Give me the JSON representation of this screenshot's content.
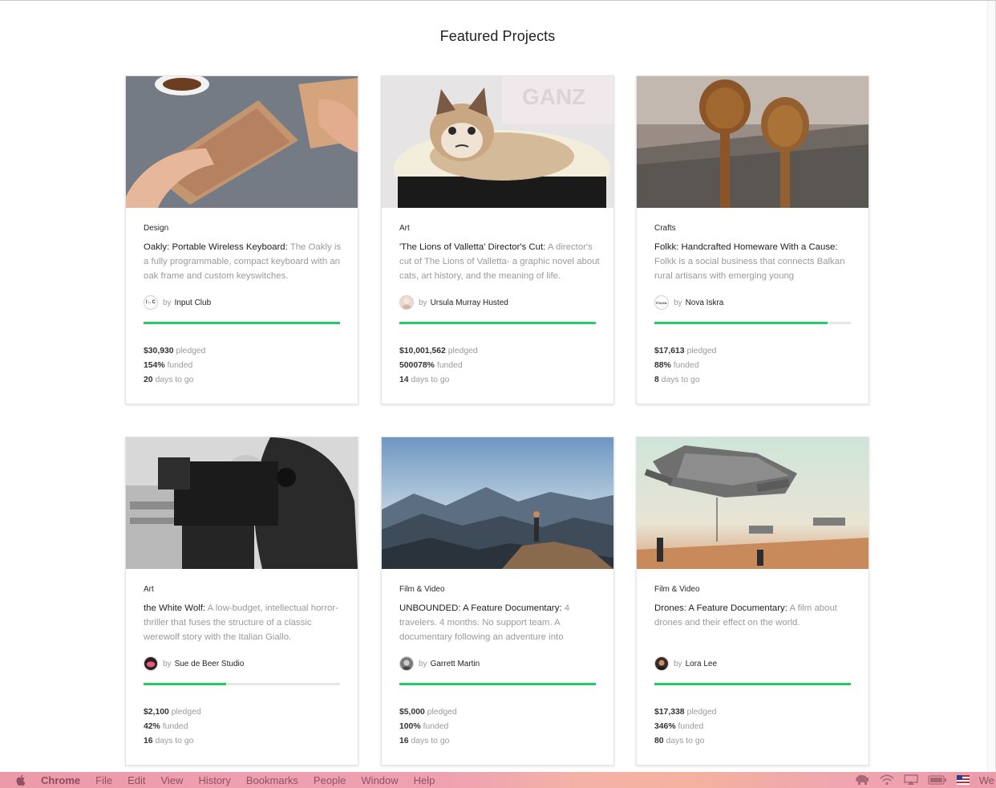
{
  "page": {
    "title": "Featured Projects",
    "by_label": "by",
    "pledged_label": "pledged",
    "funded_label": "funded",
    "days_label": "days to go"
  },
  "projects": [
    {
      "category": "Design",
      "title": "Oakly: Portable Wireless Keyboard:",
      "description": "The Oakly is a fully programmable, compact keyboard with an oak frame and custom keyswitches.",
      "creator": "Input Club",
      "avatar_icon": "input-club-logo",
      "avatar_text": "I↔C",
      "pledged": "$30,930",
      "funded": "154%",
      "funded_fraction": 1.0,
      "days": "20",
      "image": "wooden-keyboard-photo"
    },
    {
      "category": "Art",
      "title": "'The Lions of Valletta' Director's Cut:",
      "description": "A director's cut of The Lions of Valletta- a graphic novel about cats, art history, and the meaning of life.",
      "creator": "Ursula Murray Husted",
      "avatar_icon": "user-photo",
      "avatar_text": "",
      "pledged": "$10,001,562",
      "funded": "500078%",
      "funded_fraction": 1.0,
      "days": "14",
      "image": "grumpy-cat-photo"
    },
    {
      "category": "Crafts",
      "title": "Folkk: Handcrafted Homeware With a Cause:",
      "description": "Folkk is a social business that connects Balkan rural artisans with emerging young",
      "creator": "Nova Iskra",
      "avatar_icon": "folkk-logo",
      "avatar_text": "FOLKK",
      "pledged": "$17,613",
      "funded": "88%",
      "funded_fraction": 0.88,
      "days": "8",
      "image": "wooden-spoons-photo"
    },
    {
      "category": "Art",
      "title": "the White Wolf:",
      "description": "A low-budget, intellectual horror-thriller that fuses the structure of a classic werewolf story with the Italian Giallo.",
      "creator": "Sue de Beer Studio",
      "avatar_icon": "user-photo",
      "avatar_text": "",
      "pledged": "$2,100",
      "funded": "42%",
      "funded_fraction": 0.42,
      "days": "16",
      "image": "camera-operator-photo"
    },
    {
      "category": "Film & Video",
      "title": "UNBOUNDED: A Feature Documentary:",
      "description": "4 travelers. 4 months. No support team. A documentary following an adventure into",
      "creator": "Garrett Martin",
      "avatar_icon": "user-photo",
      "avatar_text": "",
      "pledged": "$5,000",
      "funded": "100%",
      "funded_fraction": 1.0,
      "days": "16",
      "image": "mountain-landscape-photo"
    },
    {
      "category": "Film & Video",
      "title": "Drones: A Feature Documentary:",
      "description": "A film about drones and their effect on the world.",
      "creator": "Lora Lee",
      "avatar_icon": "user-photo",
      "avatar_text": "",
      "pledged": "$17,338",
      "funded": "346%",
      "funded_fraction": 1.0,
      "days": "80",
      "image": "drone-aircraft-illustration"
    }
  ],
  "menubar": {
    "app": "Chrome",
    "items": [
      "File",
      "Edit",
      "View",
      "History",
      "Bookmarks",
      "People",
      "Window",
      "Help"
    ],
    "trailing_text": "We"
  },
  "colors": {
    "progress_fill": "#25cb68",
    "progress_track": "#e6e6e6",
    "muted_text": "#9a9a9a"
  }
}
